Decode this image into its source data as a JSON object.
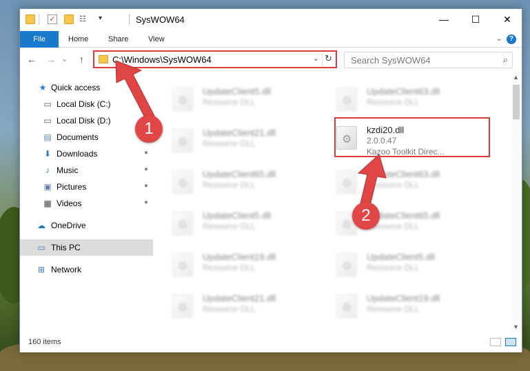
{
  "window": {
    "title": "SysWOW64",
    "minimize_glyph": "—",
    "maximize_glyph": "☐",
    "close_glyph": "✕"
  },
  "ribbon": {
    "tabs": [
      "File",
      "Home",
      "Share",
      "View"
    ],
    "collapse_glyph": "⌄",
    "help_glyph": "?"
  },
  "nav": {
    "back_glyph": "←",
    "forward_glyph": "→",
    "recent_glyph": "⌄",
    "up_glyph": "↑",
    "address": "C:\\Windows\\SysWOW64",
    "address_dropdown_glyph": "⌄",
    "refresh_glyph": "↻",
    "search_placeholder": "Search SysWOW64",
    "search_glyph": "⌕"
  },
  "sidebar": {
    "items": [
      {
        "label": "Quick access",
        "icon": "star-icon",
        "glyph": "★",
        "pinned": false
      },
      {
        "label": "Local Disk (C:)",
        "icon": "drive-icon",
        "glyph": "▭",
        "pinned": true
      },
      {
        "label": "Local Disk (D:)",
        "icon": "drive-icon",
        "glyph": "▭",
        "pinned": true
      },
      {
        "label": "Documents",
        "icon": "documents-icon",
        "glyph": "▤",
        "pinned": true
      },
      {
        "label": "Downloads",
        "icon": "download-icon",
        "glyph": "⬇",
        "pinned": true
      },
      {
        "label": "Music",
        "icon": "music-icon",
        "glyph": "♪",
        "pinned": true
      },
      {
        "label": "Pictures",
        "icon": "pictures-icon",
        "glyph": "▣",
        "pinned": true
      },
      {
        "label": "Videos",
        "icon": "videos-icon",
        "glyph": "▦",
        "pinned": true
      },
      {
        "label": "OneDrive",
        "icon": "cloud-icon",
        "glyph": "☁",
        "pinned": false
      },
      {
        "label": "This PC",
        "icon": "computer-icon",
        "glyph": "▭",
        "pinned": false
      },
      {
        "label": "Network",
        "icon": "network-icon",
        "glyph": "⊞",
        "pinned": false
      }
    ],
    "pin_glyph": "📌"
  },
  "files": {
    "left_column": [
      {
        "name": "UpdateClient5.dll",
        "desc": "Resource DLL"
      },
      {
        "name": "UpdateClient21.dll",
        "desc": "Resource DLL"
      },
      {
        "name": "UpdateClient65.dll",
        "desc": "Resource DLL"
      },
      {
        "name": "UpdateClient5.dll",
        "desc": "Resource DLL"
      },
      {
        "name": "UpdateClient19.dll",
        "desc": "Resource DLL"
      },
      {
        "name": "UpdateClient21.dll",
        "desc": "Resource DLL"
      }
    ],
    "right_column": [
      {
        "name": "UpdateClient63.dll",
        "desc": "Resource DLL"
      },
      {
        "name": "UpdateClient63.dll",
        "desc": "Resource DLL"
      },
      {
        "name": "UpdateClient65.dll",
        "desc": "Resource DLL"
      },
      {
        "name": "UpdateClient5.dll",
        "desc": "Resource DLL"
      },
      {
        "name": "UpdateClient19.dll",
        "desc": "Resource DLL"
      }
    ],
    "highlighted": {
      "name": "kzdi20.dll",
      "version": "2.0.0.47",
      "desc": "Kazoo Toolkit Direc..."
    }
  },
  "status": {
    "item_count": "160 items"
  },
  "annotations": {
    "callout_1": "1",
    "callout_2": "2",
    "color": "#e04646"
  }
}
